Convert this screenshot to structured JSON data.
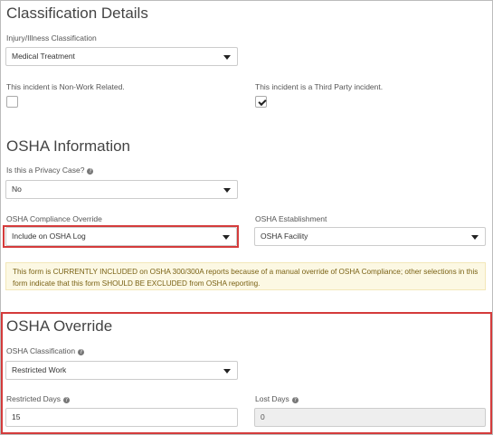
{
  "classification": {
    "title": "Classification Details",
    "injury_label": "Injury/Illness Classification",
    "injury_value": "Medical Treatment",
    "non_work_label": "This incident is Non-Work Related.",
    "non_work_checked": false,
    "third_party_label": "This incident is a Third Party incident.",
    "third_party_checked": true
  },
  "osha_info": {
    "title": "OSHA Information",
    "privacy_label": "Is this a Privacy Case?",
    "privacy_value": "No",
    "compliance_label": "OSHA Compliance Override",
    "compliance_value": "Include on OSHA Log",
    "establishment_label": "OSHA Establishment",
    "establishment_value": "OSHA Facility",
    "warning_text": "This form is CURRENTLY INCLUDED on OSHA 300/300A reports because of a manual override of OSHA Compliance; other selections in this form indicate that this form SHOULD BE EXCLUDED from OSHA reporting."
  },
  "osha_override": {
    "title": "OSHA Override",
    "classification_label": "OSHA Classification",
    "classification_value": "Restricted Work",
    "restricted_days_label": "Restricted Days",
    "restricted_days_value": "15",
    "lost_days_label": "Lost Days",
    "lost_days_value": "0"
  },
  "colors": {
    "highlight": "#d43b3b",
    "warning_bg": "#fcf8e3",
    "warning_text": "#7a6215"
  },
  "icons": {
    "help": "question-circle-icon",
    "dropdown": "caret-down-icon",
    "check": "checkmark-icon"
  }
}
